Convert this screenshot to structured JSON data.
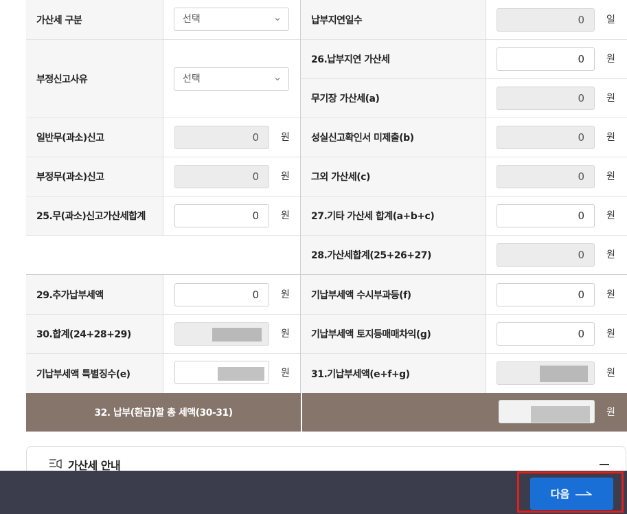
{
  "select_placeholder": "선택",
  "unit_won": "원",
  "unit_day": "일",
  "left": {
    "penalty_type": {
      "label": "가산세 구분"
    },
    "fraud_reason": {
      "label": "부정신고사유"
    },
    "general_under": {
      "label": "일반무(과소)신고",
      "value": "0"
    },
    "fraud_under": {
      "label": "부정무(과소)신고",
      "value": "0"
    },
    "sum25": {
      "label": "25.무(과소)신고가산세합계",
      "value": "0"
    },
    "add29": {
      "label": "29.추가납부세액",
      "value": "0"
    },
    "sum30": {
      "label": "30.합계(24+28+29)"
    },
    "special_e": {
      "label": "기납부세액 특별징수(e)"
    }
  },
  "right": {
    "late_days": {
      "label": "납부지연일수",
      "value": "0"
    },
    "late26": {
      "label": "26.납부지연 가산세",
      "value": "0"
    },
    "nobook_a": {
      "label": "무기장 가산세(a)",
      "value": "0"
    },
    "confirm_b": {
      "label": "성실신고확인서 미제출(b)",
      "value": "0"
    },
    "other_c": {
      "label": "그외 가산세(c)",
      "value": "0"
    },
    "sum27": {
      "label": "27.기타 가산세 합계(a+b+c)",
      "value": "0"
    },
    "sum28": {
      "label": "28.가산세합계(25+26+27)",
      "value": "0"
    },
    "occasional_f": {
      "label": "기납부세액 수시부과등(f)",
      "value": "0"
    },
    "land_g": {
      "label": "기납부세액 토지등매매차익(g)",
      "value": "0"
    },
    "prepaid31": {
      "label": "31.기납부세액(e+f+g)"
    }
  },
  "total32": {
    "label": "32. 납부(환급)할 총 세액(30-31)"
  },
  "guide": {
    "title": "가산세 안내"
  },
  "footer": {
    "next_label": "다음"
  }
}
